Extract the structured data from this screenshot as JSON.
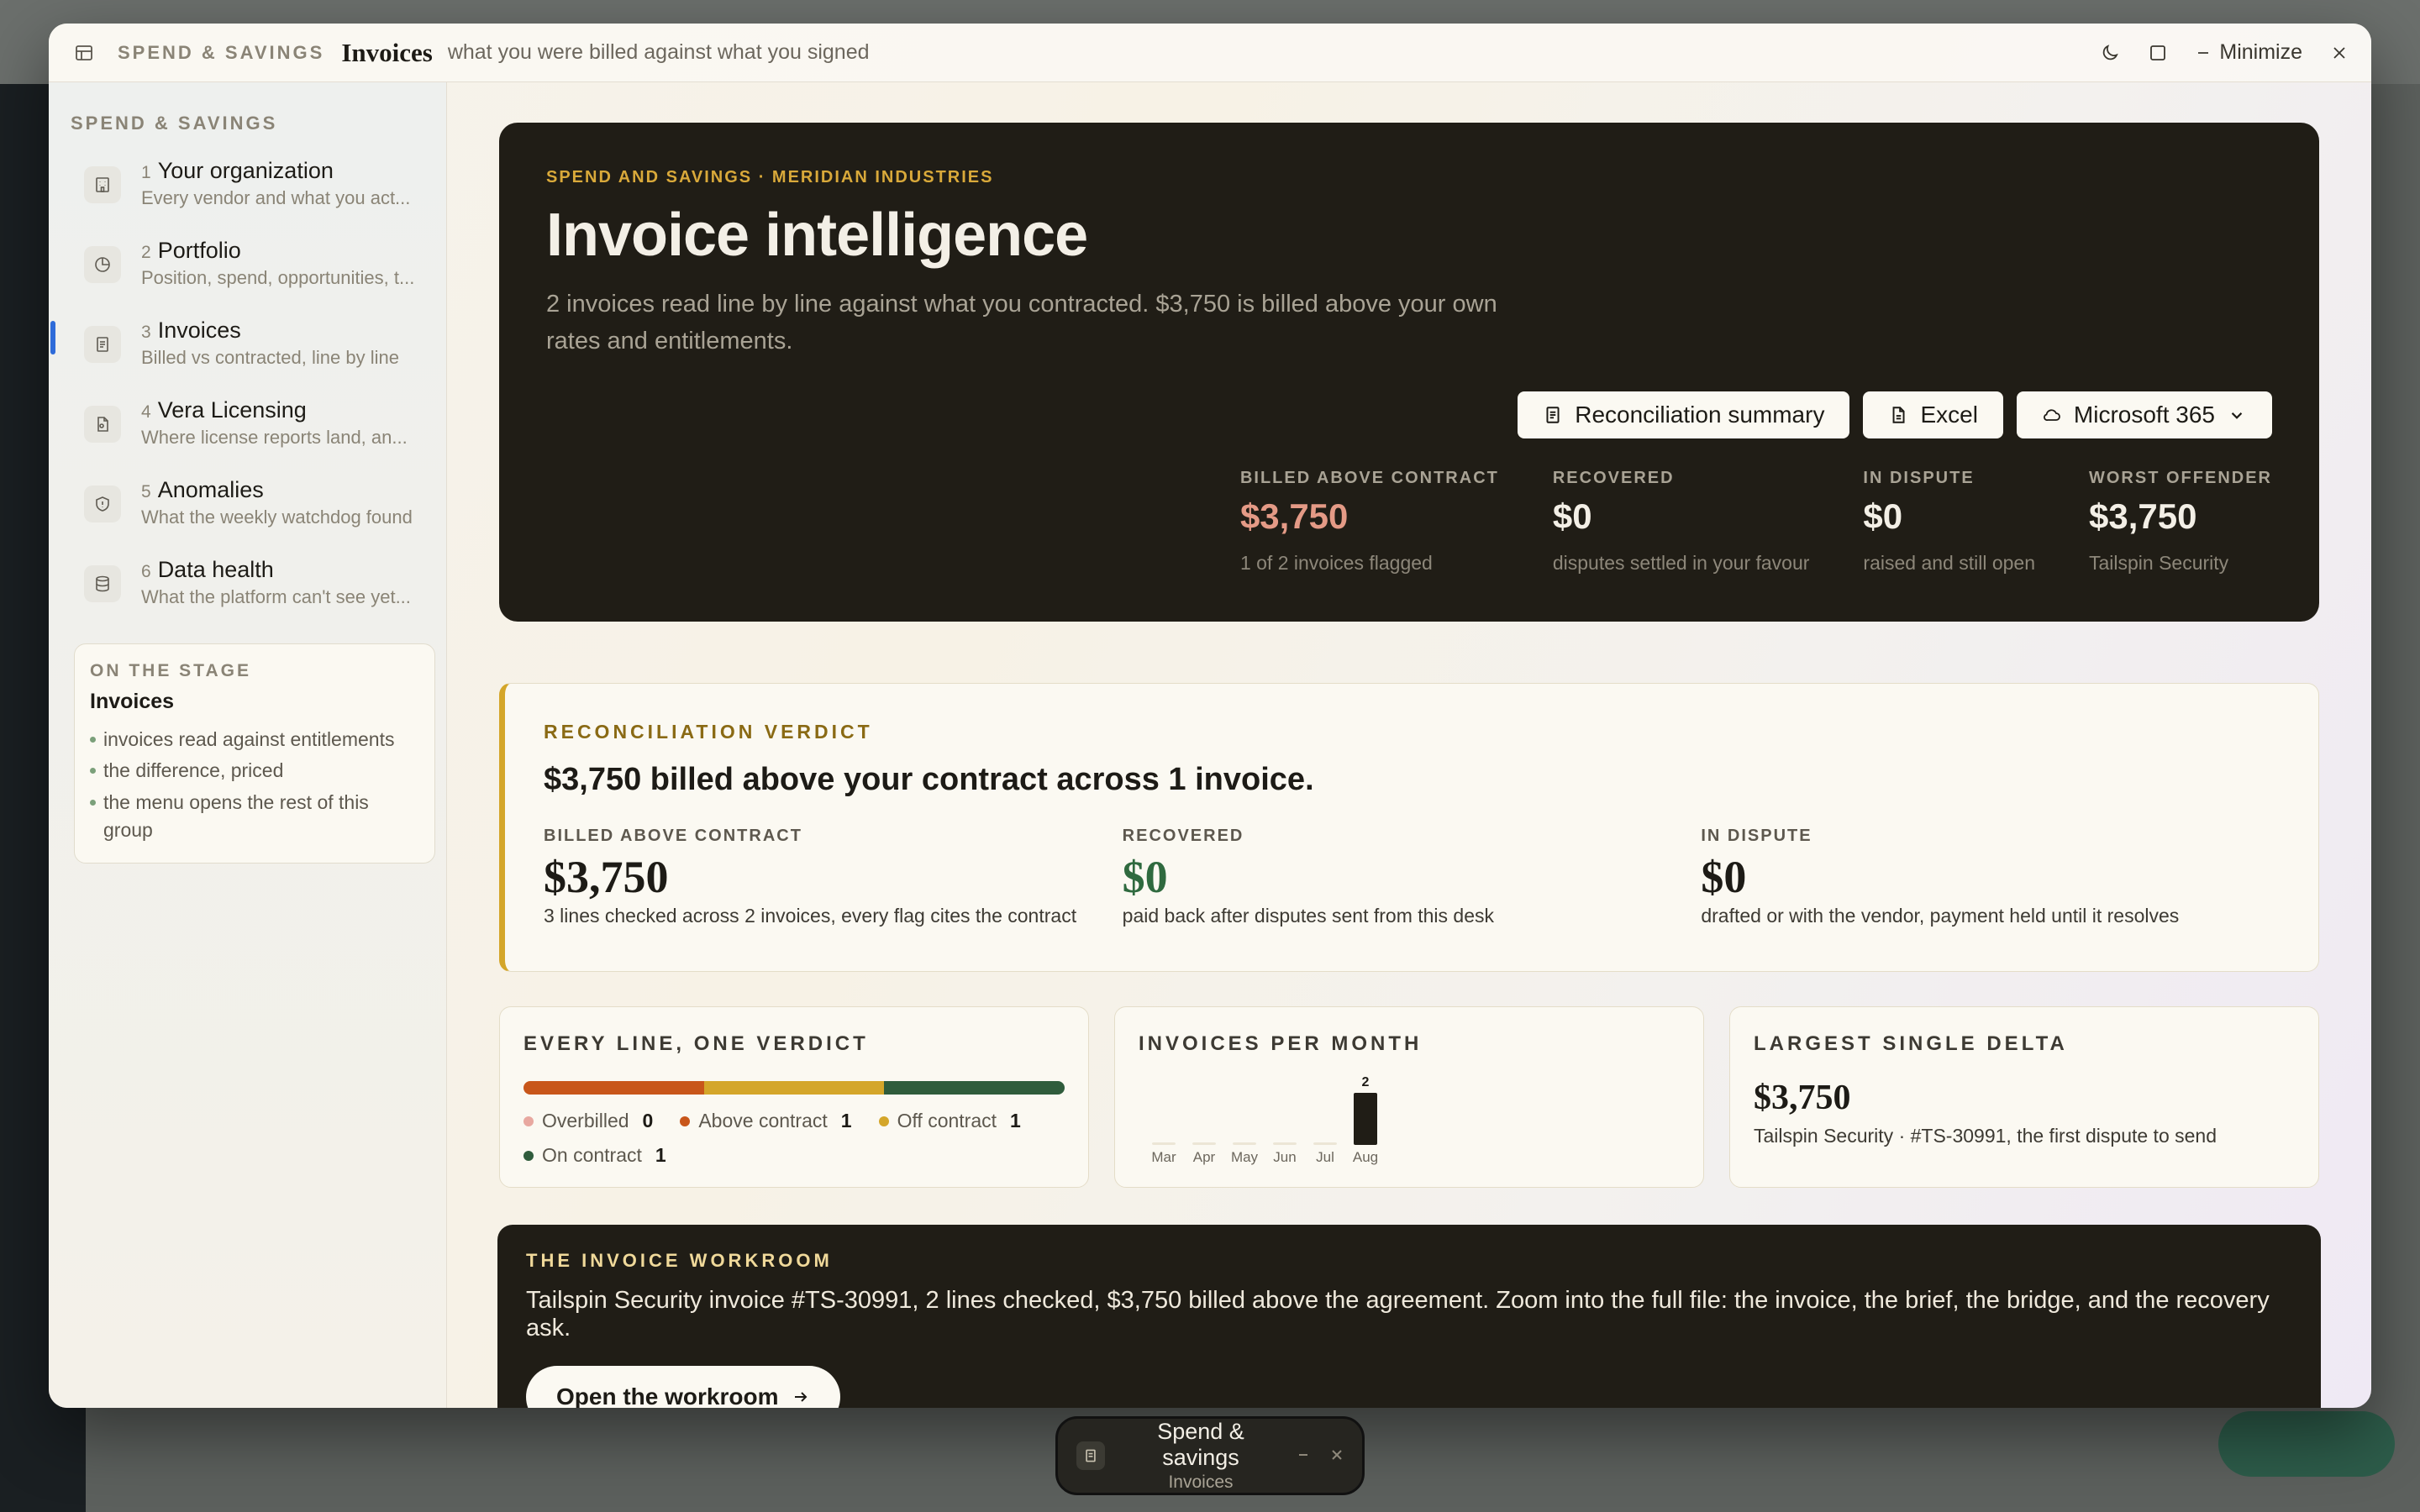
{
  "window": {
    "eyebrow": "SPEND & SAVINGS",
    "title": "Invoices",
    "subtitle": "what you were billed against what you signed",
    "minimize_label": "Minimize"
  },
  "sidebar": {
    "heading": "SPEND & SAVINGS",
    "items": [
      {
        "num": "1",
        "label": "Your organization",
        "desc": "Every vendor and what you act...",
        "icon": "building-icon"
      },
      {
        "num": "2",
        "label": "Portfolio",
        "desc": "Position, spend, opportunities, t...",
        "icon": "pie-chart-icon"
      },
      {
        "num": "3",
        "label": "Invoices",
        "desc": "Billed vs contracted, line by line",
        "icon": "document-icon"
      },
      {
        "num": "4",
        "label": "Vera Licensing",
        "desc": "Where license reports land, an...",
        "icon": "license-file-icon"
      },
      {
        "num": "5",
        "label": "Anomalies",
        "desc": "What the weekly watchdog found",
        "icon": "shield-icon"
      },
      {
        "num": "6",
        "label": "Data health",
        "desc": "What the platform can't see yet...",
        "icon": "database-icon"
      }
    ],
    "stage": {
      "eyebrow": "ON THE STAGE",
      "title": "Invoices",
      "points": [
        "invoices read against entitlements",
        "the difference, priced",
        "the menu opens the rest of this group"
      ]
    }
  },
  "hero": {
    "eyebrow": "SPEND AND SAVINGS · MERIDIAN INDUSTRIES",
    "title": "Invoice intelligence",
    "description": "2 invoices read line by line against what you contracted. $3,750 is billed above your own rates and entitlements.",
    "actions": {
      "summary": "Reconciliation summary",
      "excel": "Excel",
      "m365": "Microsoft 365"
    },
    "stats": [
      {
        "label": "BILLED ABOVE CONTRACT",
        "value": "$3,750",
        "note": "1 of 2 invoices flagged"
      },
      {
        "label": "RECOVERED",
        "value": "$0",
        "note": "disputes settled in your favour"
      },
      {
        "label": "IN DISPUTE",
        "value": "$0",
        "note": "raised and still open"
      },
      {
        "label": "WORST OFFENDER",
        "value": "$3,750",
        "note": "Tailspin Security"
      }
    ]
  },
  "verdict": {
    "eyebrow": "RECONCILIATION VERDICT",
    "headline": "$3,750 billed above your contract across 1 invoice.",
    "columns": [
      {
        "label": "BILLED ABOVE CONTRACT",
        "value": "$3,750",
        "note": "3 lines checked across 2 invoices, every flag cites the contract"
      },
      {
        "label": "RECOVERED",
        "value": "$0",
        "note": "paid back after disputes sent from this desk"
      },
      {
        "label": "IN DISPUTE",
        "value": "$0",
        "note": "drafted or with the vendor, payment held until it resolves"
      }
    ]
  },
  "line_verdict": {
    "title": "EVERY LINE, ONE VERDICT",
    "legend": [
      {
        "label": "Overbilled",
        "count": "0",
        "color": "#e8a8a0"
      },
      {
        "label": "Above contract",
        "count": "1",
        "color": "#c8561a"
      },
      {
        "label": "Off contract",
        "count": "1",
        "color": "#d4a62a"
      },
      {
        "label": "On contract",
        "count": "1",
        "color": "#2f5c3c"
      }
    ]
  },
  "invoices_per_month": {
    "title": "INVOICES PER MONTH"
  },
  "chart_data": {
    "type": "bar",
    "title": "INVOICES PER MONTH",
    "categories": [
      "Mar",
      "Apr",
      "May",
      "Jun",
      "Jul",
      "Aug"
    ],
    "values": [
      0,
      0,
      0,
      0,
      0,
      2
    ],
    "data_labels": [
      "",
      "",
      "",
      "",
      "",
      "2"
    ],
    "xlabel": "",
    "ylabel": "",
    "ylim": [
      0,
      2
    ]
  },
  "largest_delta": {
    "title": "LARGEST SINGLE DELTA",
    "value": "$3,750",
    "note": "Tailspin Security · #TS-30991, the first dispute to send"
  },
  "workroom": {
    "eyebrow": "THE INVOICE WORKROOM",
    "text": "Tailspin Security invoice #TS-30991, 2 lines checked, $3,750 billed above the agreement. Zoom into the full file: the invoice, the brief, the bridge, and the recovery ask.",
    "button": "Open the workroom"
  },
  "dock": {
    "title": "Spend & savings",
    "subtitle": "Invoices"
  }
}
